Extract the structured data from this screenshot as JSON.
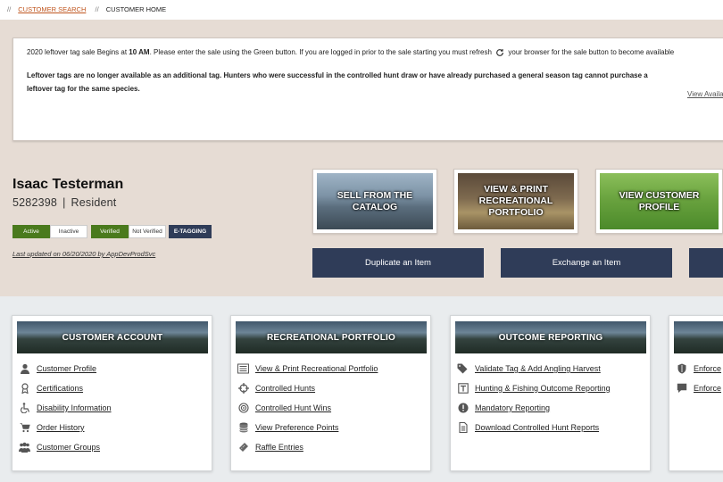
{
  "breadcrumb": {
    "sep1": "//",
    "link": "CUSTOMER SEARCH",
    "sep2": "//",
    "current": "CUSTOMER HOME"
  },
  "notice": {
    "line1_a": "2020 leftover tag sale Begins at ",
    "line1_bold": "10 AM",
    "line1_b": ".  Please enter the sale using the Green button. If you are logged in prior to the sale starting you must refresh",
    "line1_c": "your browser for the sale button to become available",
    "line2": "Leftover tags are no longer available as an additional tag.  Hunters who were successful in the controlled hunt draw or have already purchased a general season tag cannot purchase a leftover tag for the same species.",
    "view_link": "View Availa"
  },
  "customer": {
    "name": "Isaac Testerman",
    "id": "5282398",
    "divider": "|",
    "residency": "Resident",
    "status": {
      "active": "Active",
      "inactive": "Inactive",
      "verified": "Verified",
      "not_verified": "Not Verified",
      "etagging": "E-TAGGING"
    },
    "last_updated": "Last updated on 06/20/2020 by AppDevProdSvc"
  },
  "tiles": [
    {
      "label": "SELL FROM THE CATALOG"
    },
    {
      "label": "VIEW & PRINT RECREATIONAL PORTFOLIO"
    },
    {
      "label": "VIEW CUSTOMER PROFILE"
    }
  ],
  "actions": {
    "duplicate": "Duplicate an Item",
    "exchange": "Exchange an Item"
  },
  "cards": [
    {
      "title": "CUSTOMER ACCOUNT",
      "items": [
        {
          "label": "Customer Profile",
          "icon": "person-icon"
        },
        {
          "label": "Certifications",
          "icon": "ribbon-icon"
        },
        {
          "label": "Disability Information",
          "icon": "wheelchair-icon"
        },
        {
          "label": "Order History",
          "icon": "cart-icon"
        },
        {
          "label": "Customer Groups",
          "icon": "group-icon"
        }
      ]
    },
    {
      "title": "RECREATIONAL PORTFOLIO",
      "items": [
        {
          "label": "View & Print Recreational Portfolio",
          "icon": "list-icon"
        },
        {
          "label": "Controlled Hunts",
          "icon": "crosshair-icon"
        },
        {
          "label": "Controlled Hunt Wins",
          "icon": "target-icon"
        },
        {
          "label": "View Preference Points",
          "icon": "database-icon"
        },
        {
          "label": "Raffle Entries",
          "icon": "ticket-icon"
        }
      ]
    },
    {
      "title": "OUTCOME REPORTING",
      "items": [
        {
          "label": "Validate Tag & Add Angling Harvest",
          "icon": "tag-icon"
        },
        {
          "label": "Hunting & Fishing Outcome Reporting",
          "icon": "report-icon"
        },
        {
          "label": "Mandatory Reporting",
          "icon": "alert-icon"
        },
        {
          "label": "Download Controlled Hunt Reports",
          "icon": "document-icon"
        }
      ]
    },
    {
      "title": "",
      "items": [
        {
          "label": "Enforce",
          "icon": "shield-icon"
        },
        {
          "label": "Enforce",
          "icon": "comment-icon"
        }
      ]
    }
  ]
}
